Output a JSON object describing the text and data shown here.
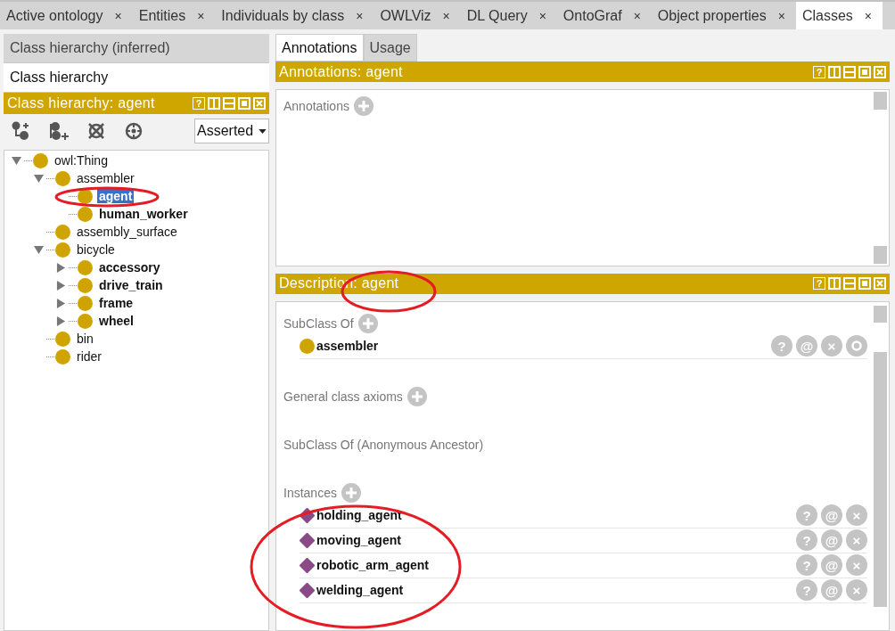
{
  "tabs": [
    {
      "label": "Active ontology",
      "close": "×",
      "selected": false
    },
    {
      "label": "Entities",
      "close": "×",
      "selected": false
    },
    {
      "label": "Individuals by class",
      "close": "×",
      "selected": false
    },
    {
      "label": "OWLViz",
      "close": "×",
      "selected": false
    },
    {
      "label": "DL Query",
      "close": "×",
      "selected": false
    },
    {
      "label": "OntoGraf",
      "close": "×",
      "selected": false
    },
    {
      "label": "Object properties",
      "close": "×",
      "selected": false
    },
    {
      "label": "Classes",
      "close": "×",
      "selected": true
    }
  ],
  "left": {
    "views": [
      {
        "label": "Class hierarchy (inferred)",
        "selected": false
      },
      {
        "label": "Class hierarchy",
        "selected": true
      }
    ],
    "header": {
      "title": "Class hierarchy: agent",
      "help": "?"
    },
    "mode": "Asserted",
    "tree": [
      {
        "label": "owl:Thing",
        "bold": false,
        "selected": false,
        "expanded": true,
        "children": [
          {
            "label": "assembler",
            "bold": false,
            "selected": false,
            "expanded": true,
            "children": [
              {
                "label": "agent",
                "bold": true,
                "selected": true
              },
              {
                "label": "human_worker",
                "bold": true,
                "selected": false
              }
            ]
          },
          {
            "label": "assembly_surface",
            "bold": false,
            "selected": false
          },
          {
            "label": "bicycle",
            "bold": false,
            "selected": false,
            "expanded": true,
            "children": [
              {
                "label": "accessory",
                "bold": true,
                "selected": false,
                "expanded": false
              },
              {
                "label": "drive_train",
                "bold": true,
                "selected": false,
                "expanded": false
              },
              {
                "label": "frame",
                "bold": true,
                "selected": false,
                "expanded": false
              },
              {
                "label": "wheel",
                "bold": true,
                "selected": false,
                "expanded": false
              }
            ]
          },
          {
            "label": "bin",
            "bold": false,
            "selected": false
          },
          {
            "label": "rider",
            "bold": false,
            "selected": false
          }
        ]
      }
    ]
  },
  "right": {
    "views": [
      {
        "label": "Annotations",
        "selected": true
      },
      {
        "label": "Usage",
        "selected": false
      }
    ],
    "annotations_header": {
      "title": "Annotations: agent",
      "help": "?"
    },
    "annotations_label": "Annotations",
    "description_header": {
      "title": "Description: agent",
      "help": "?"
    },
    "sections": [
      {
        "title": "SubClass Of",
        "addable": true,
        "items": [
          {
            "kind": "class",
            "label": "assembler",
            "actions": [
              "?",
              "@",
              "×"
            ],
            "editable": true
          }
        ]
      },
      {
        "title": "General class axioms",
        "addable": true
      },
      {
        "title": "SubClass Of (Anonymous Ancestor)",
        "addable": false
      },
      {
        "title": "Instances",
        "addable": true,
        "items": [
          {
            "kind": "individual",
            "label": "holding_agent",
            "actions": [
              "?",
              "@",
              "×"
            ],
            "editable": false
          },
          {
            "kind": "individual",
            "label": "moving_agent",
            "actions": [
              "?",
              "@",
              "×"
            ],
            "editable": false
          },
          {
            "kind": "individual",
            "label": "robotic_arm_agent",
            "actions": [
              "?",
              "@",
              "×"
            ],
            "editable": false
          },
          {
            "kind": "individual",
            "label": "welding_agent",
            "actions": [
              "?",
              "@",
              "×"
            ],
            "editable": false
          }
        ]
      }
    ]
  }
}
